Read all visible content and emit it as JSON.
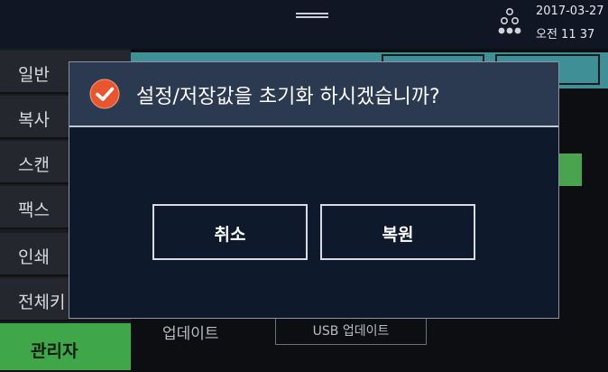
{
  "status_bar": {
    "date": "2017-03-27",
    "time": "오전 11 37"
  },
  "sidebar": {
    "items": [
      {
        "label": "일반"
      },
      {
        "label": "복사"
      },
      {
        "label": "스캔"
      },
      {
        "label": "팩스"
      },
      {
        "label": "인쇄"
      },
      {
        "label": "전체키"
      },
      {
        "label": "관리자"
      }
    ]
  },
  "main": {
    "update_label": "업데이트",
    "usb_update_button": "USB 업데이트"
  },
  "dialog": {
    "title": "설정/저장값을 초기화 하시겠습니까?",
    "cancel_label": "취소",
    "restore_label": "복원"
  },
  "colors": {
    "accent_green": "#3fa74a",
    "teal": "#3f8f96",
    "dialog_header": "#2b3a50",
    "check_icon": "#e8552e"
  },
  "icons": [
    "network-icon",
    "check-circle-icon"
  ]
}
